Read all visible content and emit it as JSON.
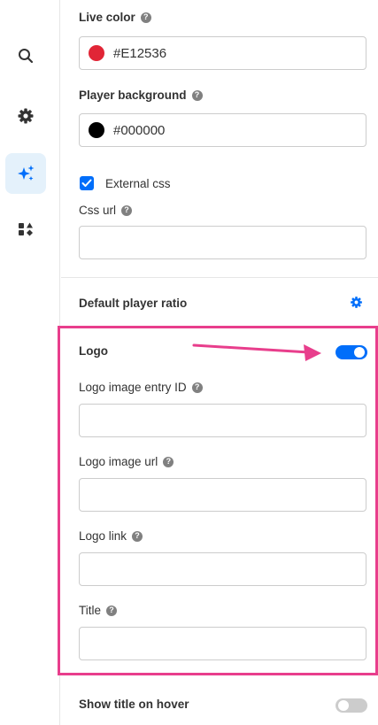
{
  "sidebar": {
    "items": [
      {
        "icon": "search-icon",
        "active": false
      },
      {
        "icon": "gear-icon",
        "active": false
      },
      {
        "icon": "sparkles-icon",
        "active": true
      },
      {
        "icon": "shapes-icon",
        "active": false
      }
    ]
  },
  "fields": {
    "live_color": {
      "label": "Live color",
      "value": "#E12536",
      "swatch": "#E12536"
    },
    "player_background": {
      "label": "Player background",
      "value": "#000000",
      "swatch": "#000000"
    },
    "external_css": {
      "label": "External css",
      "checked": true
    },
    "css_url": {
      "label": "Css url",
      "value": ""
    }
  },
  "default_player_ratio": {
    "label": "Default player ratio"
  },
  "logo": {
    "label": "Logo",
    "enabled": true,
    "entry_id": {
      "label": "Logo image entry ID",
      "value": ""
    },
    "image_url": {
      "label": "Logo image url",
      "value": ""
    },
    "link": {
      "label": "Logo link",
      "value": ""
    },
    "title": {
      "label": "Title",
      "value": ""
    }
  },
  "show_title_on_hover": {
    "label": "Show title on hover",
    "enabled": false
  },
  "help_glyph": "?",
  "colors": {
    "accent": "#006EFA",
    "highlight": "#E83E8C",
    "active_nav_bg": "#E4F1FB"
  }
}
